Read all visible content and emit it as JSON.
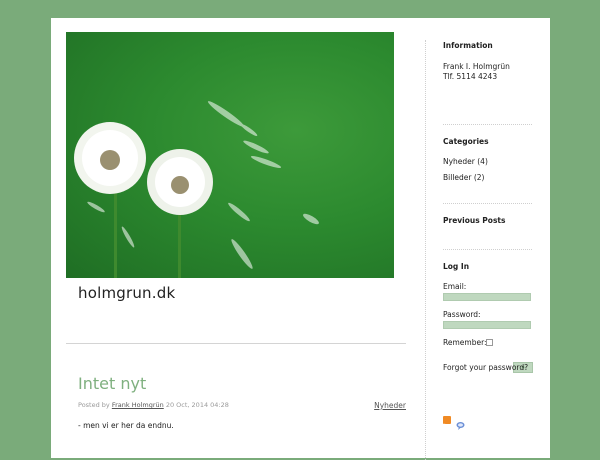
{
  "site": {
    "title": "holmgrun.dk"
  },
  "post": {
    "title": "Intet nyt",
    "posted_by_prefix": "Posted by",
    "author": "Frank Holmgrün",
    "date": "20 Oct, 2014 04:28",
    "category": "Nyheder",
    "body": "- men vi er her da endnu."
  },
  "sidebar": {
    "information": {
      "heading": "Information",
      "name": "Frank I. Holmgrün",
      "phone": "Tlf. 5114 4243"
    },
    "categories": {
      "heading": "Categories",
      "items": [
        "Nyheder (4)",
        "Billeder (2)"
      ]
    },
    "previous_posts": {
      "heading": "Previous Posts"
    },
    "login": {
      "heading": "Log In",
      "email_label": "Email:",
      "password_label": "Password:",
      "remember_label": "Remember:",
      "button_label": "»",
      "forgot_link": "Forgot your password?"
    }
  },
  "icons": {
    "rss": "rss-icon",
    "comments": "comments-feed-icon"
  },
  "colors": {
    "background": "#7aab7a",
    "accent": "#7fb07f",
    "input": "#bfd8bf"
  }
}
